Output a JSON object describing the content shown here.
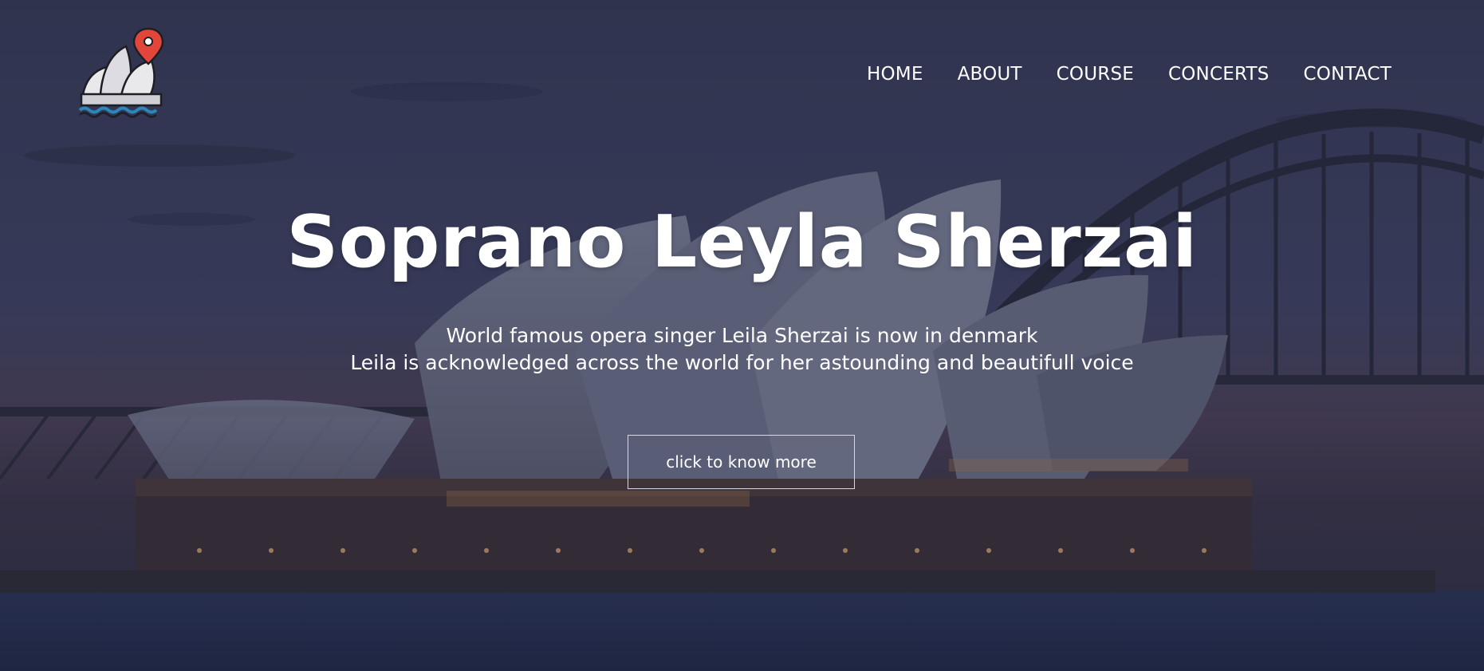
{
  "logo": {
    "icon": "opera-house-location-icon"
  },
  "nav": {
    "items": [
      {
        "label": "HOME"
      },
      {
        "label": "ABOUT"
      },
      {
        "label": "COURSE"
      },
      {
        "label": "CONCERTS"
      },
      {
        "label": "CONTACT"
      }
    ]
  },
  "hero": {
    "title": "Soprano Leyla Sherzai",
    "subtitle_line1": "World famous opera singer Leila Sherzai is now in denmark",
    "subtitle_line2": "Leila is acknowledged across the world for her astounding and beautifull voice",
    "cta_label": "click to know more"
  },
  "colors": {
    "overlay": "#2b2d45",
    "sky_top": "#3a3e5c",
    "water": "#2f3a5c",
    "pin": "#e2463a",
    "wave": "#2a87b8"
  }
}
